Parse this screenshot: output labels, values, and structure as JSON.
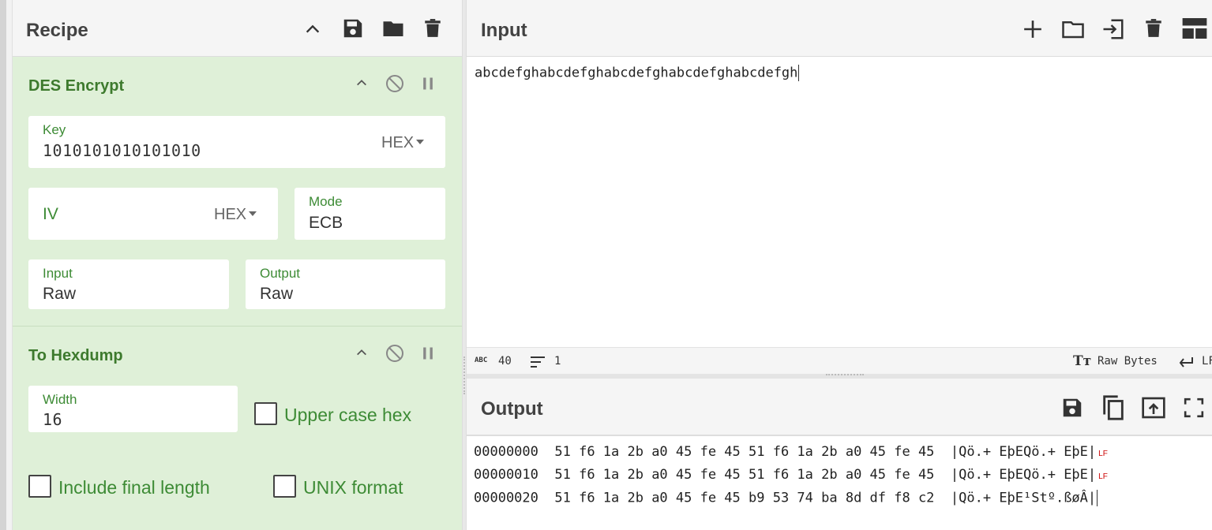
{
  "recipe": {
    "title": "Recipe",
    "operations": {
      "des": {
        "title": "DES Encrypt",
        "key": {
          "label": "Key",
          "value": "1010101010101010",
          "format": "HEX"
        },
        "iv": {
          "label": "IV",
          "value": "",
          "format": "HEX"
        },
        "mode": {
          "label": "Mode",
          "value": "ECB"
        },
        "input": {
          "label": "Input",
          "value": "Raw"
        },
        "output": {
          "label": "Output",
          "value": "Raw"
        }
      },
      "hexdump": {
        "title": "To Hexdump",
        "width": {
          "label": "Width",
          "value": "16"
        },
        "upper_case_hex": {
          "label": "Upper case hex",
          "checked": false
        },
        "include_final_length": {
          "label": "Include final length",
          "checked": false
        },
        "unix_format": {
          "label": "UNIX format",
          "checked": false
        }
      }
    }
  },
  "input": {
    "title": "Input",
    "text": "abcdefghabcdefghabcdefghabcdefghabcdefgh",
    "status": {
      "abc_icon": "ABC",
      "length": "40",
      "lines": "1",
      "encoding": "Raw Bytes",
      "eol": "LF"
    }
  },
  "output": {
    "title": "Output",
    "lines": [
      {
        "offset": "00000000",
        "hex": "51 f6 1a 2b a0 45 fe 45 51 f6 1a 2b a0 45 fe 45",
        "ascii": "|Qö.+ EþEQö.+ EþE|",
        "eol": "LF"
      },
      {
        "offset": "00000010",
        "hex": "51 f6 1a 2b a0 45 fe 45 51 f6 1a 2b a0 45 fe 45",
        "ascii": "|Qö.+ EþEQö.+ EþE|",
        "eol": "LF"
      },
      {
        "offset": "00000020",
        "hex": "51 f6 1a 2b a0 45 fe 45 b9 53 74 ba 8d df f8 c2",
        "ascii": "|Qö.+ EþE¹Stº.ßøÂ|",
        "eol": ""
      }
    ]
  },
  "icons": {
    "recipe_header": [
      "chevron-up-icon",
      "save-icon",
      "folder-icon",
      "trash-icon"
    ],
    "input_header": [
      "plus-icon",
      "folder-icon",
      "import-icon",
      "trash-icon",
      "layout-icon"
    ],
    "output_header": [
      "save-icon",
      "copy-icon",
      "replace-input-icon",
      "fullscreen-icon"
    ],
    "operation": [
      "chevron-up-icon",
      "disable-icon",
      "pause-icon"
    ]
  },
  "colors": {
    "accent_green": "#3d8b35",
    "recipe_bg": "#dff0d8",
    "header_bg": "#f5f5f5",
    "lf_marker": "#cc0000"
  }
}
